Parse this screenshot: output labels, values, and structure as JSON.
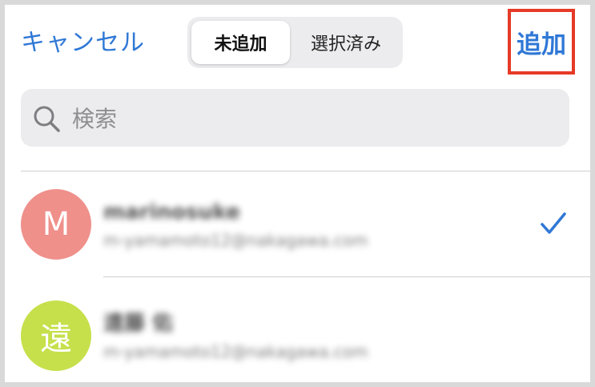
{
  "header": {
    "cancel_label": "キャンセル",
    "segments": [
      {
        "label": "未追加",
        "selected": true
      },
      {
        "label": "選択済み",
        "selected": false
      }
    ],
    "add_label": "追加"
  },
  "search": {
    "placeholder": "検索",
    "icon": "search-icon"
  },
  "contacts": [
    {
      "initial": "M",
      "avatar_color": "#ef908b",
      "name": "marinosuke",
      "email": "m-yamamoto12@nakagawa.com",
      "checked": true,
      "icon": "checkmark-icon"
    },
    {
      "initial": "遠",
      "avatar_color": "#c5e04b",
      "name": "遠藤 佑",
      "email": "m-yamamoto12@nakagawa.com",
      "checked": false
    }
  ],
  "colors": {
    "accent": "#2f78d6",
    "highlight": "#e53a27"
  }
}
